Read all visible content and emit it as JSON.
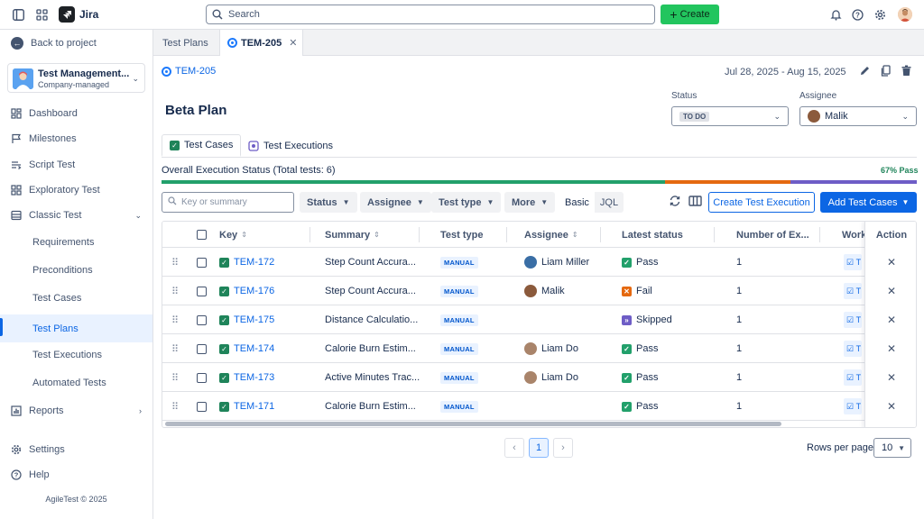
{
  "topbar": {
    "app_name": "Jira",
    "search_placeholder": "Search",
    "create_label": "Create"
  },
  "sidebar": {
    "back_label": "Back to project",
    "project_name": "Test Management...",
    "project_type": "Company-managed",
    "items": [
      {
        "label": "Dashboard",
        "icon": "dashboard-icon"
      },
      {
        "label": "Milestones",
        "icon": "flag-icon"
      },
      {
        "label": "Script Test",
        "icon": "script-icon"
      },
      {
        "label": "Exploratory Test",
        "icon": "grid-icon"
      },
      {
        "label": "Classic Test",
        "icon": "list-icon"
      }
    ],
    "sub_items": [
      "Requirements",
      "Preconditions",
      "Test Cases",
      "Test Plans",
      "Test Executions",
      "Automated Tests"
    ],
    "active_sub": "Test Plans",
    "reports_label": "Reports",
    "settings_label": "Settings",
    "help_label": "Help",
    "footer": "AgileTest © 2025"
  },
  "tabs": [
    {
      "label": "Test Plans"
    },
    {
      "label": "TEM-205"
    }
  ],
  "plan": {
    "key": "TEM-205",
    "date_range": "Jul 28, 2025 - Aug 15, 2025",
    "title": "Beta Plan",
    "status_label": "Status",
    "status_value": "TO DO",
    "assignee_label": "Assignee",
    "assignee_value": "Malik"
  },
  "subtabs": [
    "Test Cases",
    "Test Executions"
  ],
  "execution": {
    "label": "Overall Execution Status (Total tests: 6)",
    "pass_text": "67% Pass",
    "segments": [
      {
        "name": "pass",
        "fraction": 0.6667,
        "color": "#22A06B"
      },
      {
        "name": "fail",
        "fraction": 0.1667,
        "color": "#E56910"
      },
      {
        "name": "skipped",
        "fraction": 0.1667,
        "color": "#6E5DC6"
      }
    ]
  },
  "filters": {
    "search_placeholder": "Key or summary",
    "status": "Status",
    "assignee": "Assignee",
    "test_type": "Test type",
    "more": "More",
    "basic": "Basic",
    "jql": "JQL",
    "create_execution": "Create Test Execution",
    "add_test_cases": "Add Test Cases"
  },
  "table": {
    "headers": {
      "key": "Key",
      "summary": "Summary",
      "test_type": "Test type",
      "assignee": "Assignee",
      "latest_status": "Latest status",
      "number_of_ex": "Number of Ex...",
      "work": "Work",
      "action": "Action"
    },
    "rows": [
      {
        "key": "TEM-172",
        "summary": "Step Count Accura...",
        "type": "MANUAL",
        "assignee": "Liam Miller",
        "status": "Pass",
        "count": "1",
        "work": "T"
      },
      {
        "key": "TEM-176",
        "summary": "Step Count Accura...",
        "type": "MANUAL",
        "assignee": "Malik",
        "status": "Fail",
        "count": "1",
        "work": "T"
      },
      {
        "key": "TEM-175",
        "summary": "Distance Calculatio...",
        "type": "MANUAL",
        "assignee": "",
        "status": "Skipped",
        "count": "1",
        "work": "T"
      },
      {
        "key": "TEM-174",
        "summary": "Calorie Burn Estim...",
        "type": "MANUAL",
        "assignee": "Liam Do",
        "status": "Pass",
        "count": "1",
        "work": "T"
      },
      {
        "key": "TEM-173",
        "summary": "Active Minutes Trac...",
        "type": "MANUAL",
        "assignee": "Liam Do",
        "status": "Pass",
        "count": "1",
        "work": "T"
      },
      {
        "key": "TEM-171",
        "summary": "Calorie Burn Estim...",
        "type": "MANUAL",
        "assignee": "",
        "status": "Pass",
        "count": "1",
        "work": "T"
      }
    ],
    "action_symbol": "✕"
  },
  "pagination": {
    "current_page": "1",
    "rows_per_page_label": "Rows per page",
    "rows_per_page": "10"
  },
  "colors": {
    "accent": "#0C66E4",
    "create": "#22C55E",
    "pass": "#22A06B",
    "fail": "#E56910",
    "skipped": "#6E5DC6"
  }
}
